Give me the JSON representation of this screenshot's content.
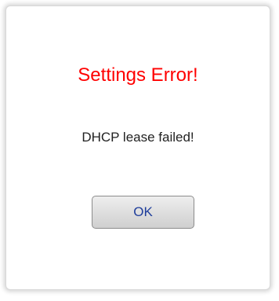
{
  "dialog": {
    "title": "Settings Error!",
    "message": "DHCP lease failed!",
    "ok_label": "OK"
  },
  "colors": {
    "title": "#ff0000",
    "button_text": "#1e3d9b"
  }
}
